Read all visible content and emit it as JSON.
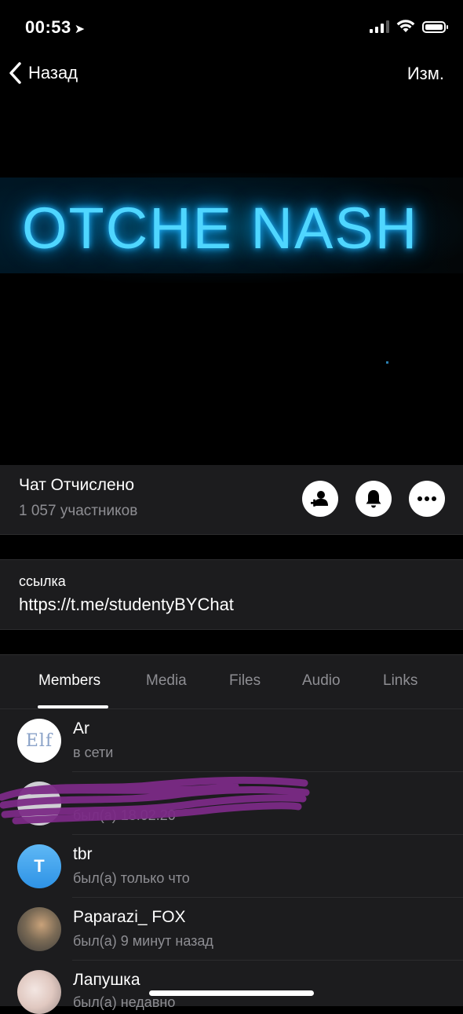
{
  "status_bar": {
    "time": "00:53"
  },
  "nav": {
    "back_label": "Назад",
    "edit_label": "Изм."
  },
  "hero": {
    "title": "OTCHE NASH"
  },
  "chat": {
    "name": "Чат Отчислено",
    "members_count": "1 057 участников"
  },
  "link": {
    "label": "ссылка",
    "value": "https://t.me/studentyBYChat"
  },
  "tabs": [
    "Members",
    "Media",
    "Files",
    "Audio",
    "Links"
  ],
  "members": [
    {
      "name": "Ar",
      "status": "в сети",
      "avatar_text": "Elf",
      "avatar_color": "#ffffff"
    },
    {
      "name": "",
      "status": "был(а) 18.02.20",
      "avatar_text": "",
      "avatar_color": "#cfcfd4"
    },
    {
      "name": "tbr",
      "status": "был(а) только что",
      "avatar_text": "T",
      "avatar_color": "#4aa8ef"
    },
    {
      "name": "Paparazi_ FOX",
      "status": "был(а) 9 минут назад",
      "avatar_text": "",
      "avatar_color": "#7a6a55"
    },
    {
      "name": "Лапушка",
      "status": "был(а) недавно",
      "avatar_text": "",
      "avatar_color": "#e9d9d4"
    }
  ],
  "colors": {
    "accent_neon": "#4fd6ff",
    "panel": "#1c1c1e",
    "secondary_text": "#8e8e93",
    "scribble": "#7b2a86"
  }
}
